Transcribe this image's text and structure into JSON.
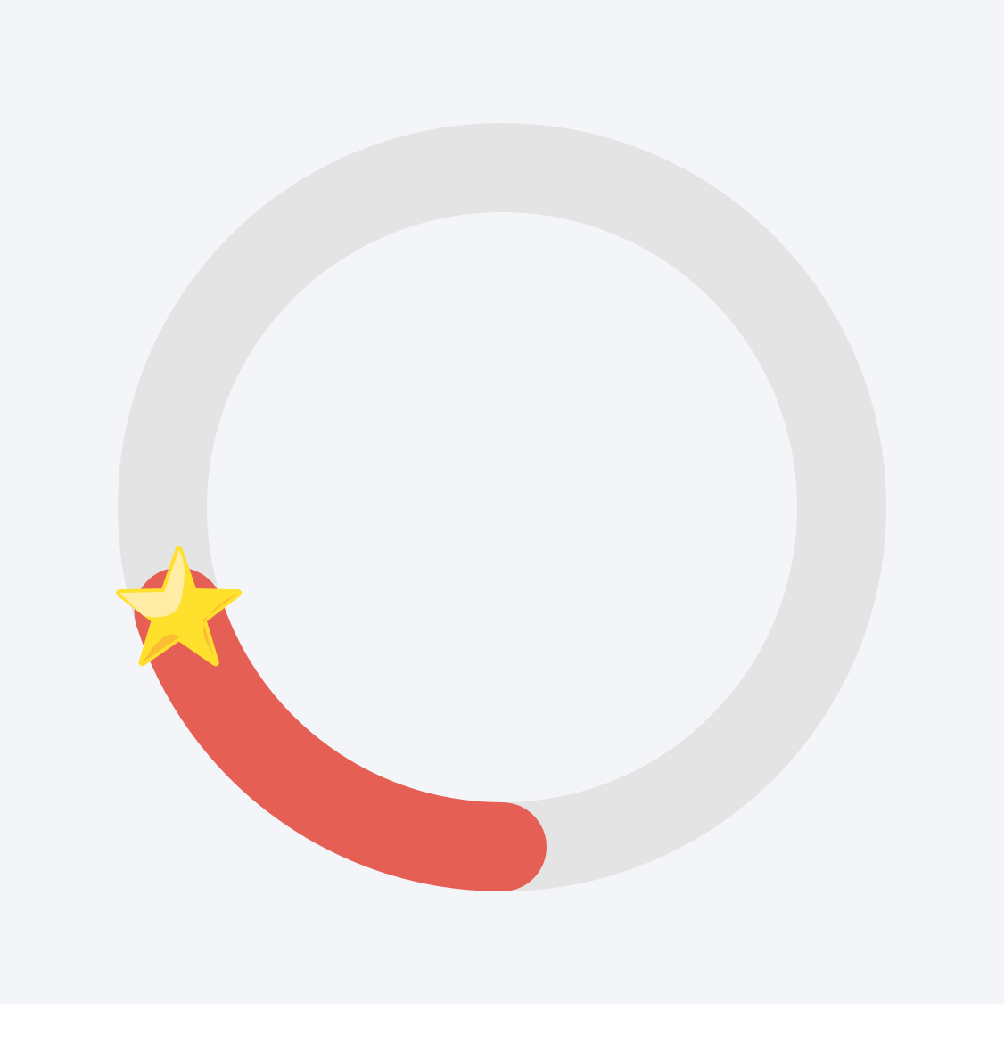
{
  "progress_ring": {
    "progress_fraction": 0.2,
    "start": "bottom",
    "direction": "clockwise",
    "colors": {
      "background": "#f4f5f8",
      "track": "#e4e4e4",
      "progress": "#e65f55",
      "star_main": "#ffe02c",
      "star_highlight": "#ffeda5",
      "star_shade": "#fbbd33"
    },
    "marker_icon": "star-icon"
  }
}
